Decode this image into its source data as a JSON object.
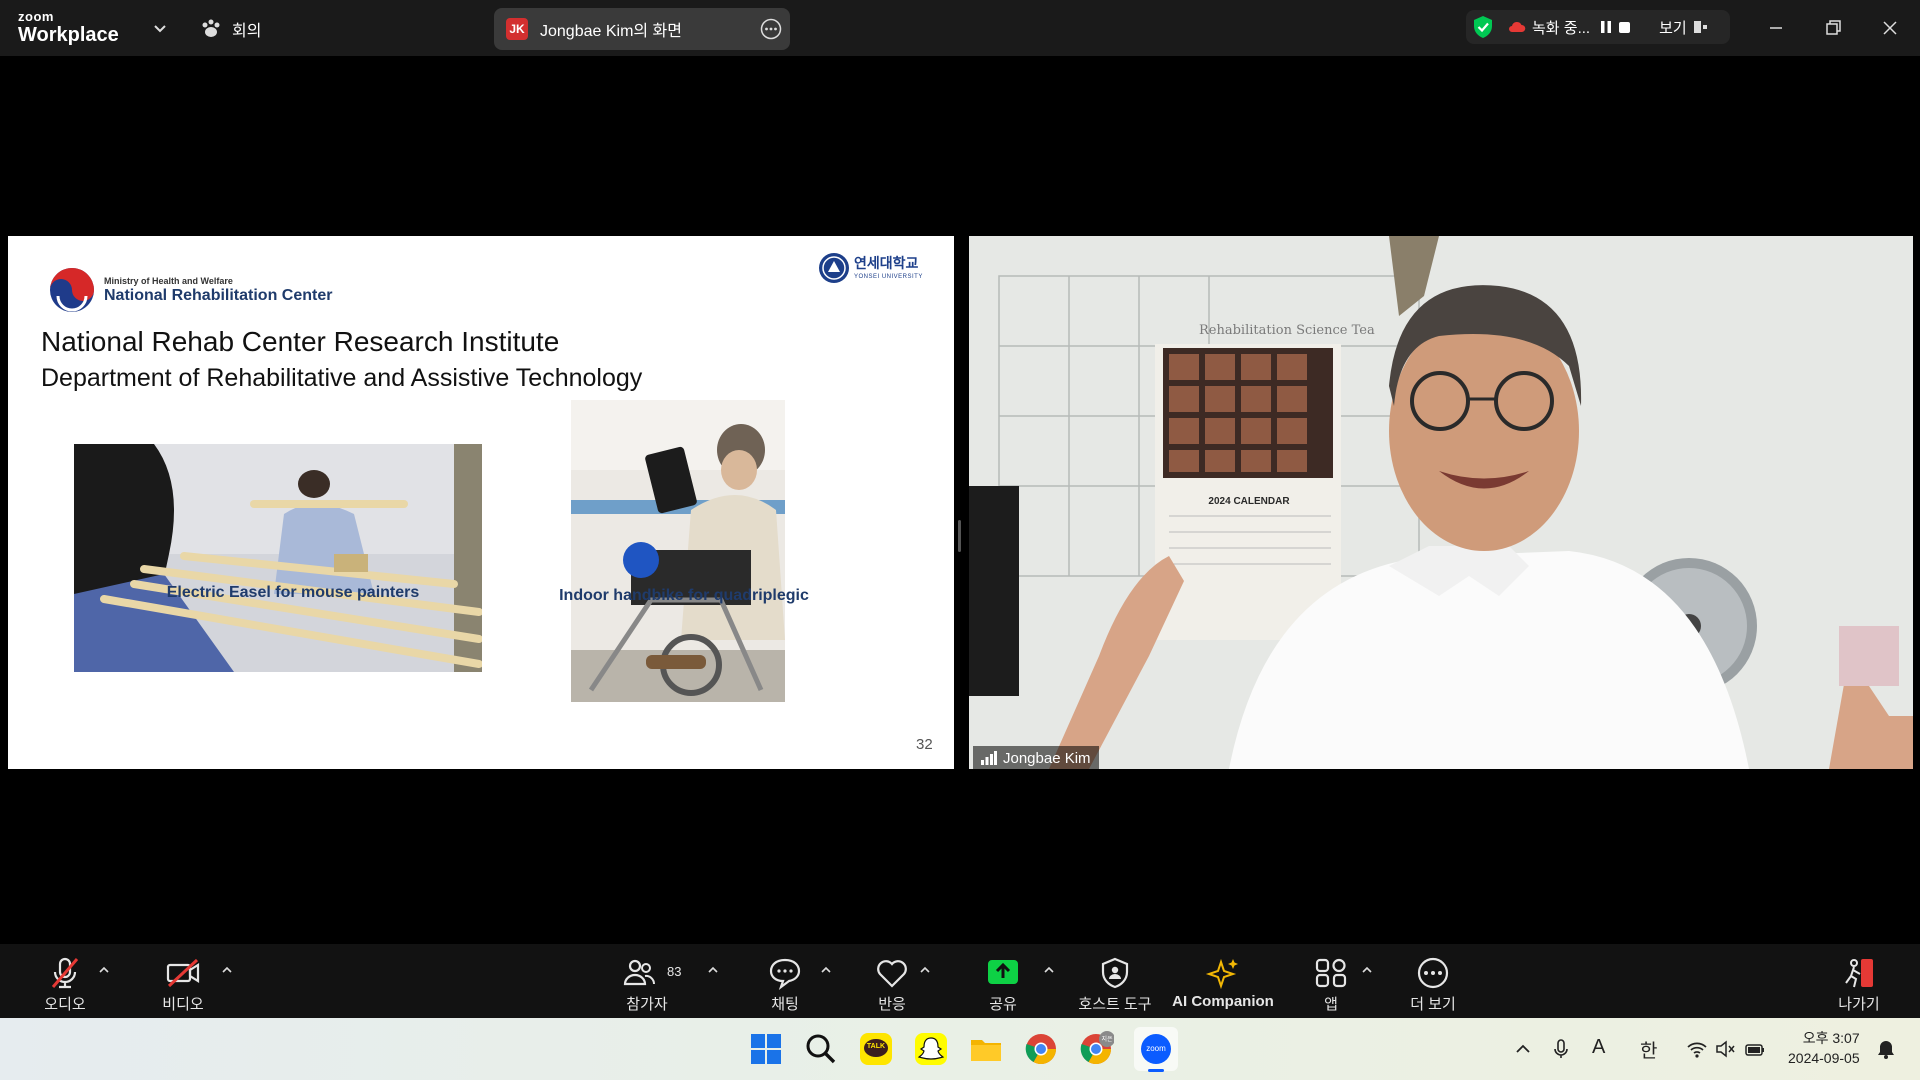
{
  "topbar": {
    "brand_small": "zoom",
    "brand_big": "Workplace",
    "meeting_label": "회의",
    "share_badge": "JK",
    "share_title": "Jongbae Kim의 화면",
    "recording_label": "녹화 중...",
    "view_label": "보기"
  },
  "slide": {
    "org_small": "Ministry of Health and Welfare",
    "org_big": "National Rehabilitation Center",
    "yonsei_ko": "연세대학교",
    "yonsei_en": "YONSEI UNIVERSITY",
    "title": "National Rehab Center Research Institute",
    "subtitle": "Department of Rehabilitative and Assistive Technology",
    "caption_left": "Electric Easel for mouse painters",
    "caption_right": "Indoor handbike for quadriplegic",
    "page_number": "32",
    "calendar_text": "2024 CALENDAR"
  },
  "video": {
    "participant_name": "Jongbae Kim",
    "whiteboard_text": "Rehabilitation Science Tea"
  },
  "toolbar": {
    "audio": "오디오",
    "video": "비디오",
    "participants": "참가자",
    "participant_count": "83",
    "chat": "채팅",
    "reactions": "반응",
    "share": "공유",
    "host_tools": "호스트 도구",
    "ai_companion": "AI Companion",
    "apps": "앱",
    "more": "더 보기",
    "leave": "나가기"
  },
  "taskbar": {
    "time": "오후 3:07",
    "date": "2024-09-05",
    "ime_a": "A",
    "ime_han": "한",
    "kakao": "TALK",
    "zoom_app": "zoom",
    "chrome_badge": "지은"
  },
  "colors": {
    "accent_green": "#00c853",
    "share_green": "#0ed145",
    "mute_red": "#e53935",
    "ai_gold": "#f2b705"
  }
}
